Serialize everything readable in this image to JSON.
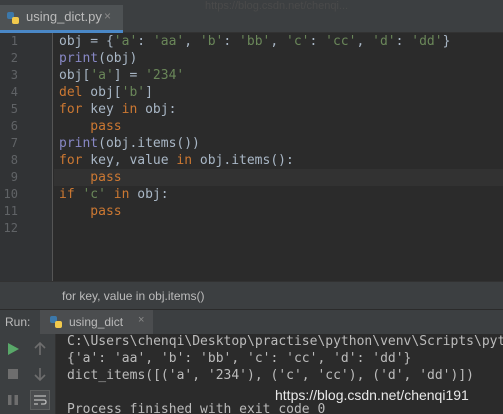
{
  "editor_tab": {
    "label": "using_dict.py",
    "close": "×"
  },
  "faint_path": "https://blog.csdn.net/chenqi...",
  "line_numbers": [
    "1",
    "2",
    "3",
    "4",
    "5",
    "6",
    "7",
    "8",
    "9",
    "10",
    "11",
    "12"
  ],
  "code": {
    "l1": {
      "a": "obj = {",
      "b": "'a'",
      "c": ": ",
      "d": "'aa'",
      "e": ", ",
      "f": "'b'",
      "g": ": ",
      "h": "'bb'",
      "i": ", ",
      "j": "'c'",
      "k": ": ",
      "l": "'cc'",
      "m": ", ",
      "n": "'d'",
      "o": ": ",
      "p": "'dd'",
      "q": "}"
    },
    "l2": {
      "a": "print",
      "b": "(obj)"
    },
    "l3": {
      "a": "obj[",
      "b": "'a'",
      "c": "] = ",
      "d": "'234'"
    },
    "l4": {
      "a": "del",
      "b": " obj[",
      "c": "'b'",
      "d": "]"
    },
    "l5": {
      "a": "for",
      "b": " key ",
      "c": "in",
      "d": " obj:"
    },
    "l6": {
      "a": "    pass"
    },
    "l7": {
      "a": "print",
      "b": "(obj.items())"
    },
    "l8": {
      "a": "for",
      "b": " key, value ",
      "c": "in",
      "d": " obj.items():"
    },
    "l9": {
      "a": "    pass"
    },
    "l10": {
      "a": "if",
      "b": " ",
      "c": "'c'",
      "d": " ",
      "e": "in",
      "f": " obj:"
    },
    "l11": {
      "a": "    pass"
    }
  },
  "hint": "for key, value in obj.items()",
  "run_panel": {
    "label": "Run:",
    "tab_label": "using_dict",
    "tab_close": "×",
    "output": [
      "C:\\Users\\chenqi\\Desktop\\practise\\python\\venv\\Scripts\\python.exe",
      "{'a': 'aa', 'b': 'bb', 'c': 'cc', 'd': 'dd'}",
      "dict_items([('a', '234'), ('c', 'cc'), ('d', 'dd')])",
      "",
      "Process finished with exit code 0"
    ]
  },
  "watermark": "https://blog.csdn.net/chenqi191",
  "colors": {
    "keyword": "#cc7832",
    "string": "#6a8759",
    "builtin": "#8888c6",
    "text": "#a9b7c6",
    "run_green": "#59a869"
  }
}
